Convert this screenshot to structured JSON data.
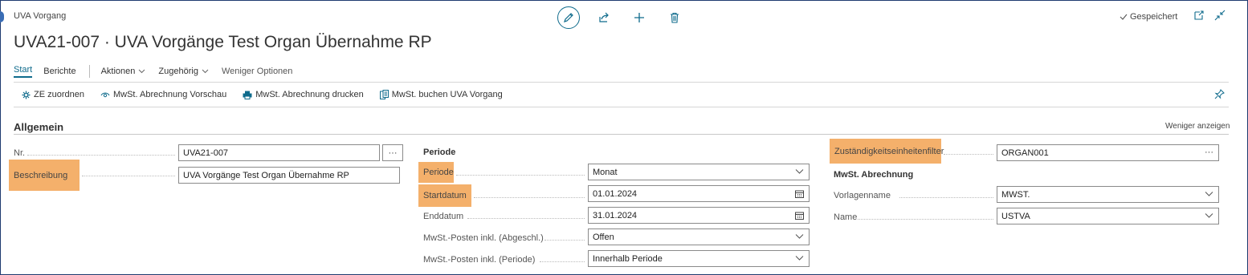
{
  "page": {
    "label": "UVA Vorgang",
    "title": "UVA21-007 · UVA Vorgänge Test Organ Übernahme RP",
    "saved_status": "Gespeichert"
  },
  "actionbar": {
    "tab_start": "Start",
    "tab_berichte": "Berichte",
    "aktionen": "Aktionen",
    "zugehoerig": "Zugehörig",
    "weniger_optionen": "Weniger Optionen"
  },
  "commands": {
    "ze_zuordnen": "ZE zuordnen",
    "vorschau": "MwSt. Abrechnung Vorschau",
    "drucken": "MwSt. Abrechnung drucken",
    "buchen": "MwSt. buchen UVA Vorgang"
  },
  "section": {
    "title": "Allgemein",
    "less_link": "Weniger anzeigen"
  },
  "left": {
    "nr_label": "Nr.",
    "nr_value": "UVA21-007",
    "nr_button": "···",
    "beschreibung_label": "Beschreibung",
    "beschreibung_value": "UVA Vorgänge Test Organ Übernahme RP"
  },
  "middle": {
    "group_title": "Periode",
    "periode_label": "Periode",
    "periode_value": "Monat",
    "startdatum_label": "Startdatum",
    "startdatum_value": "01.01.2024",
    "enddatum_label": "Enddatum",
    "enddatum_value": "31.01.2024",
    "posten_abgeschl_label": "MwSt.-Posten inkl. (Abgeschl.)",
    "posten_abgeschl_value": "Offen",
    "posten_periode_label": "MwSt.-Posten inkl. (Periode)",
    "posten_periode_value": "Innerhalb Periode"
  },
  "right": {
    "filter_label": "Zuständigkeitseinheitenfilter",
    "filter_value": "ORGAN001",
    "filter_button": "···",
    "group_title": "MwSt. Abrechnung",
    "vorlagenname_label": "Vorlagenname",
    "vorlagenname_value": "MWST.",
    "name_label": "Name",
    "name_value": "USTVA"
  },
  "colors": {
    "accent": "#0f6b8c",
    "highlight": "#f4b06b",
    "frame": "#1f3b70"
  }
}
